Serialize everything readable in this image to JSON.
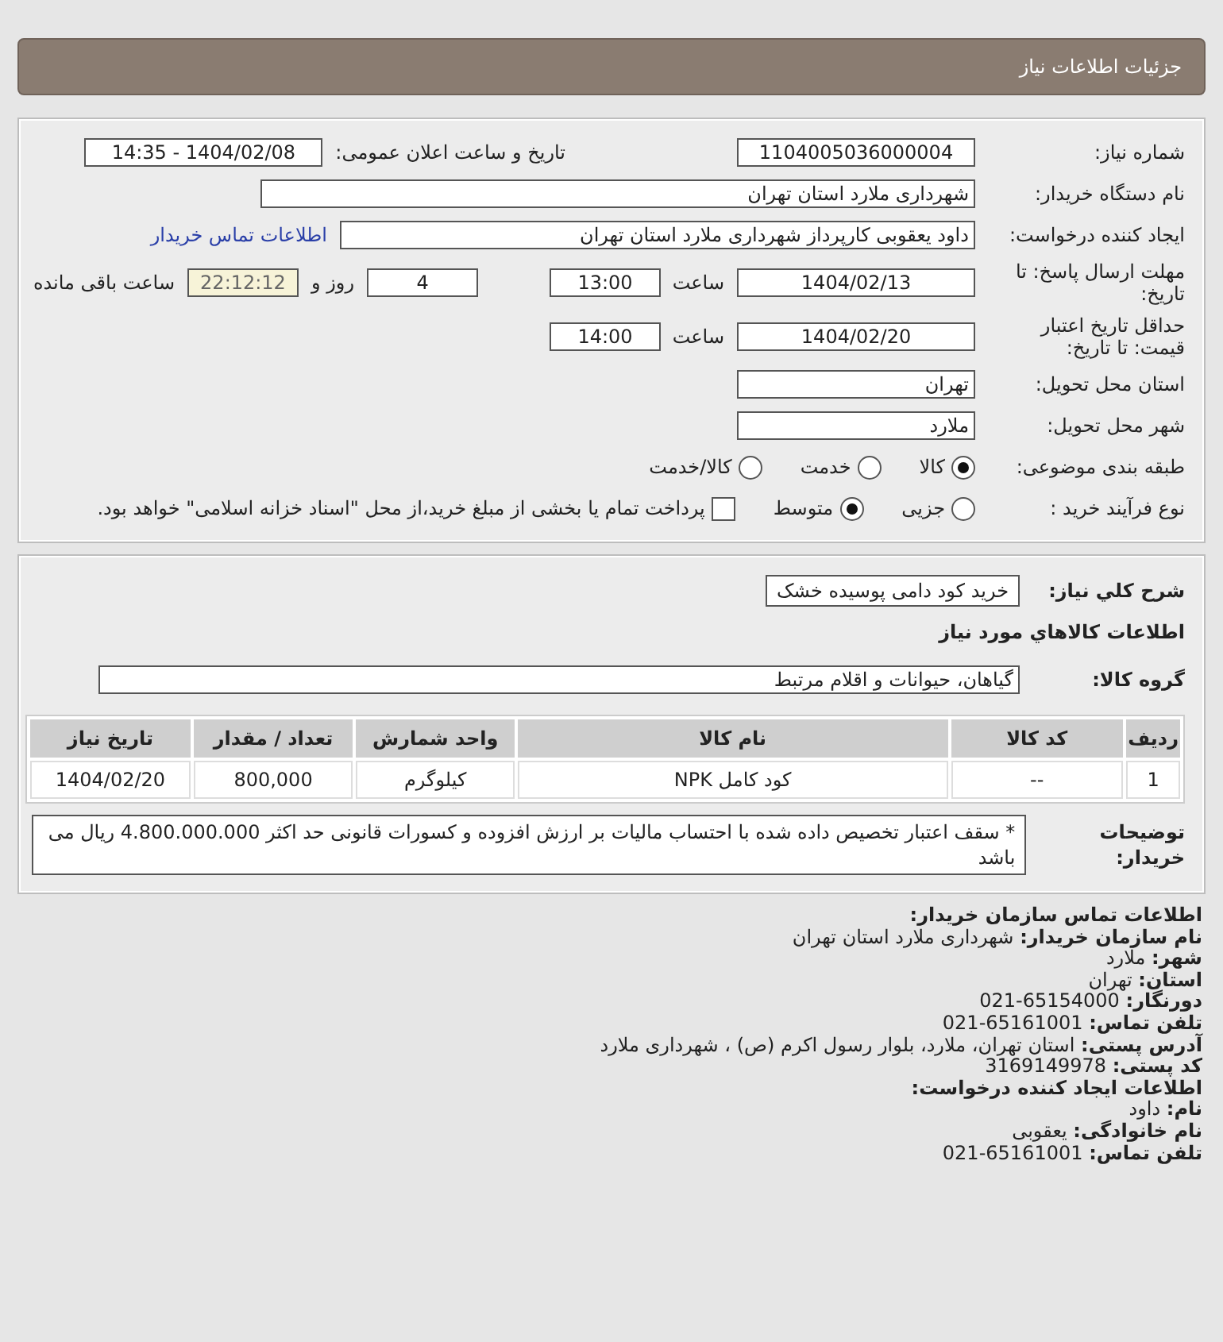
{
  "header": {
    "title": "جزئیات اطلاعات نیاز"
  },
  "details": {
    "need_number": {
      "label": "شماره نیاز:",
      "value": "1104005036000004"
    },
    "announce": {
      "label": "تاریخ و ساعت اعلان عمومی:",
      "value": "1404/02/08 - 14:35"
    },
    "buyer_org": {
      "label": "نام دستگاه خریدار:",
      "value": "شهرداری ملارد استان تهران"
    },
    "creator": {
      "label": "ایجاد کننده درخواست:",
      "value": "داود یعقوبی کارپرداز  شهرداری ملارد استان تهران",
      "link": "اطلاعات تماس خریدار"
    },
    "deadline": {
      "label": "مهلت ارسال پاسخ: تا تاریخ:",
      "date": "1404/02/13",
      "time_label": "ساعت",
      "time": "13:00",
      "days": "4",
      "days_label": "روز و",
      "remaining": "22:12:12",
      "remaining_label": "ساعت باقی مانده"
    },
    "validity": {
      "label": "حداقل تاریخ اعتبار قیمت: تا تاریخ:",
      "date": "1404/02/20",
      "time_label": "ساعت",
      "time": "14:00"
    },
    "province": {
      "label": "استان محل تحویل:",
      "value": "تهران"
    },
    "city": {
      "label": "شهر محل تحویل:",
      "value": "ملارد"
    },
    "category": {
      "label": "طبقه بندی موضوعی:",
      "options": [
        {
          "label": "کالا",
          "selected": true
        },
        {
          "label": "خدمت",
          "selected": false
        },
        {
          "label": "کالا/خدمت",
          "selected": false
        }
      ]
    },
    "process": {
      "label": "نوع فرآیند خرید :",
      "options": [
        {
          "label": "جزیی",
          "selected": false
        },
        {
          "label": "متوسط",
          "selected": true
        }
      ],
      "treasury": {
        "checked": false,
        "label": "پرداخت تمام یا بخشی از مبلغ خرید،از محل \"اسناد خزانه اسلامی\" خواهد بود."
      }
    }
  },
  "summary": {
    "label": "شرح کلي نیاز:",
    "value": "خرید کود دامی پوسیده خشک"
  },
  "goods": {
    "title": "اطلاعات کالاهاي مورد نیاز",
    "group_label": "گروه کالا:",
    "group": "گیاهان، حیوانات و اقلام مرتبط",
    "table": {
      "columns": [
        "ردیف",
        "کد کالا",
        "نام کالا",
        "واحد شمارش",
        "تعداد / مقدار",
        "تاریخ نیاز"
      ],
      "rows": [
        [
          "1",
          "--",
          "کود کامل NPK",
          "کیلوگرم",
          "800,000",
          "1404/02/20"
        ]
      ]
    }
  },
  "notes": {
    "label": "توضیحات خریدار:",
    "value": "* سقف اعتبار تخصیص داده شده با احتساب مالیات بر ارزش افزوده و کسورات قانونی حد اکثر 4.800.000.000 ریال می باشد"
  },
  "contact": [
    {
      "kind": "heading",
      "text": "اطلاعات تماس سازمان خریدار:"
    },
    {
      "kind": "field",
      "text": "**نام سازمان خریدار:** شهرداری ملارد استان تهران"
    },
    {
      "kind": "field",
      "text": "**شهر:** ملارد"
    },
    {
      "kind": "field",
      "text": "**استان:** تهران"
    },
    {
      "kind": "field",
      "text": "**دورنگار:** 65154000-021"
    },
    {
      "kind": "field",
      "text": "**تلفن تماس:** 65161001-021"
    },
    {
      "kind": "field",
      "text": "**آدرس پستی:** استان تهران، ملارد، بلوار رسول اکرم (ص) ، شهرداری ملارد"
    },
    {
      "kind": "field",
      "text": "**کد پستی:** 3169149978"
    },
    {
      "kind": "heading",
      "text": "اطلاعات ایجاد کننده درخواست:"
    },
    {
      "kind": "field",
      "text": "**نام:** داود"
    },
    {
      "kind": "field",
      "text": "**نام خانوادگی:** یعقوبی"
    },
    {
      "kind": "field",
      "text": "**تلفن تماس:** 65161001-021"
    }
  ]
}
